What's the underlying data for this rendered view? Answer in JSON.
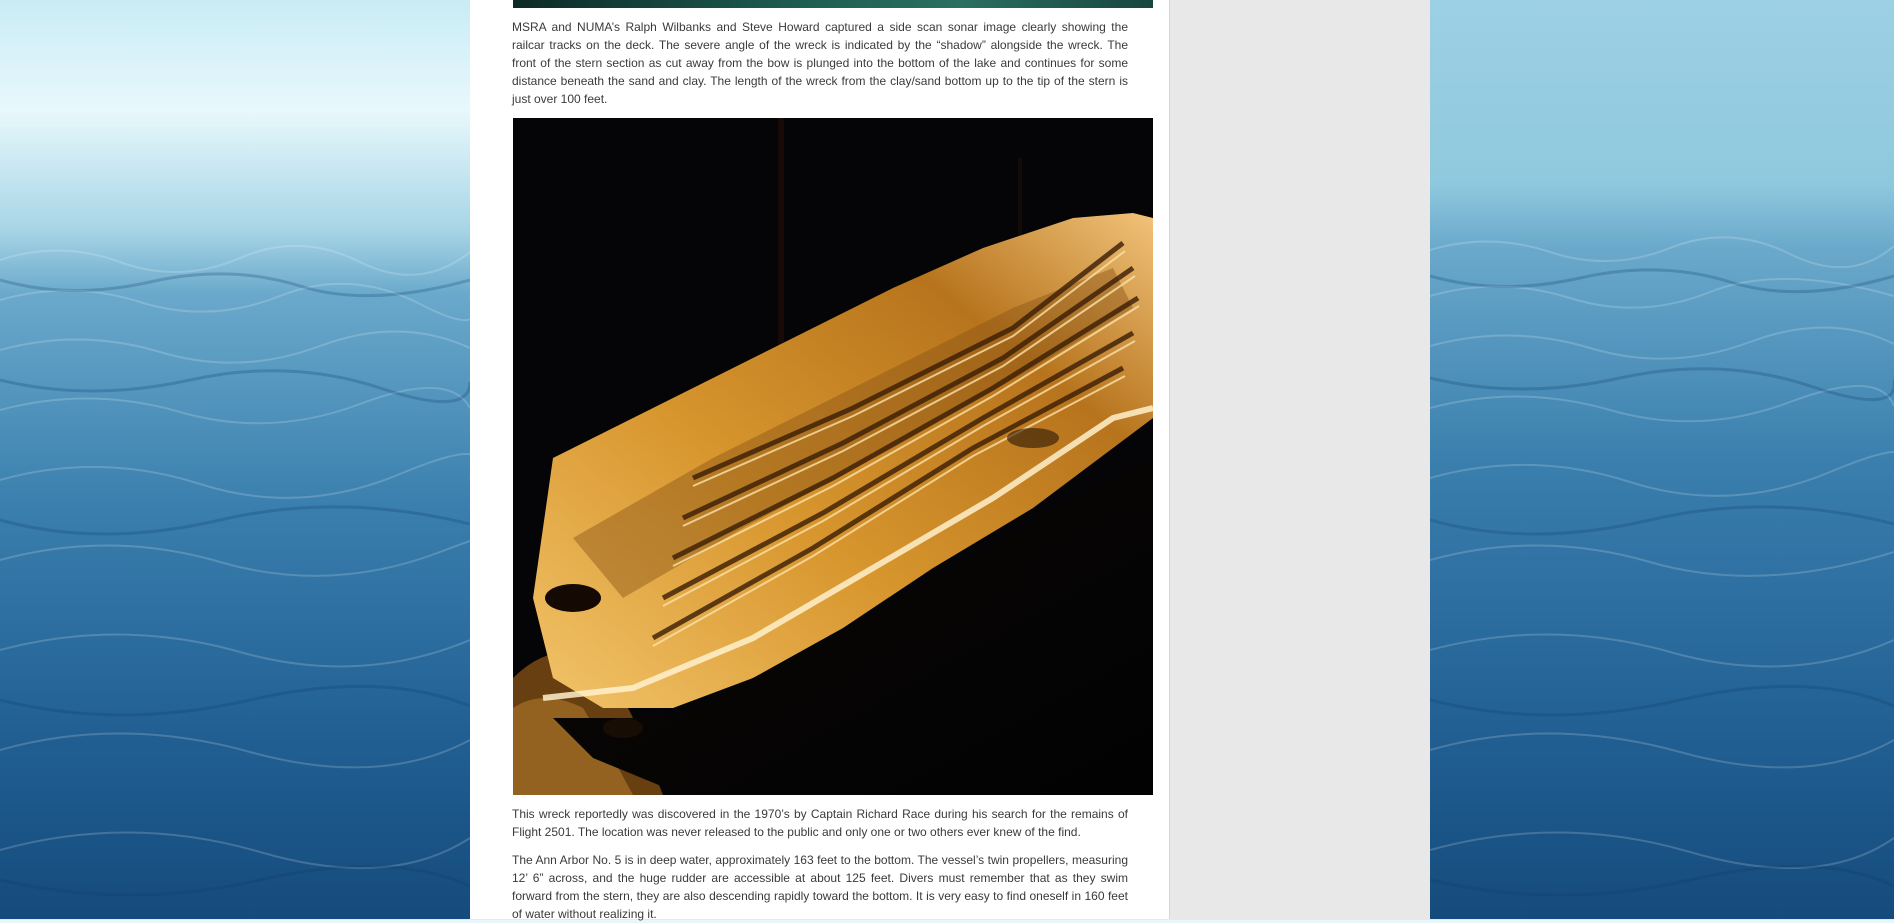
{
  "article": {
    "para1": "MSRA and NUMA’s Ralph Wilbanks and Steve Howard captured a side scan sonar image clearly showing the railcar tracks on the deck. The severe angle of the wreck is indicated by the “shadow” alongside the wreck. The front of the stern section as cut away from the bow is plunged into the bottom of the lake and continues for some distance beneath the sand and clay. The length of the wreck from the clay/sand bottom up to the tip of the stern is just over 100 feet.",
    "para2": "This wreck  reportedly was discovered in the 1970’s by Captain Richard Race during his search for the remains of Flight 2501. The location was never released to the public and only one or two others ever knew of the find.",
    "para3": "The Ann Arbor No. 5 is in deep water, approximately 163 feet to the bottom. The vessel’s twin propellers, measuring 12’ 6” across, and the huge rudder are accessible at about 125 feet. Divers must remember that as they swim forward from the stern, they are also descending rapidly toward the bottom. It is very easy to find oneself in 160 feet of water without realizing it."
  },
  "colors": {
    "page_bg": "#e8e8e8",
    "content_bg": "#ffffff",
    "text": "#3a3a3a",
    "sonar_bg": "#050406",
    "sonar_wreck": "#d8962e"
  }
}
